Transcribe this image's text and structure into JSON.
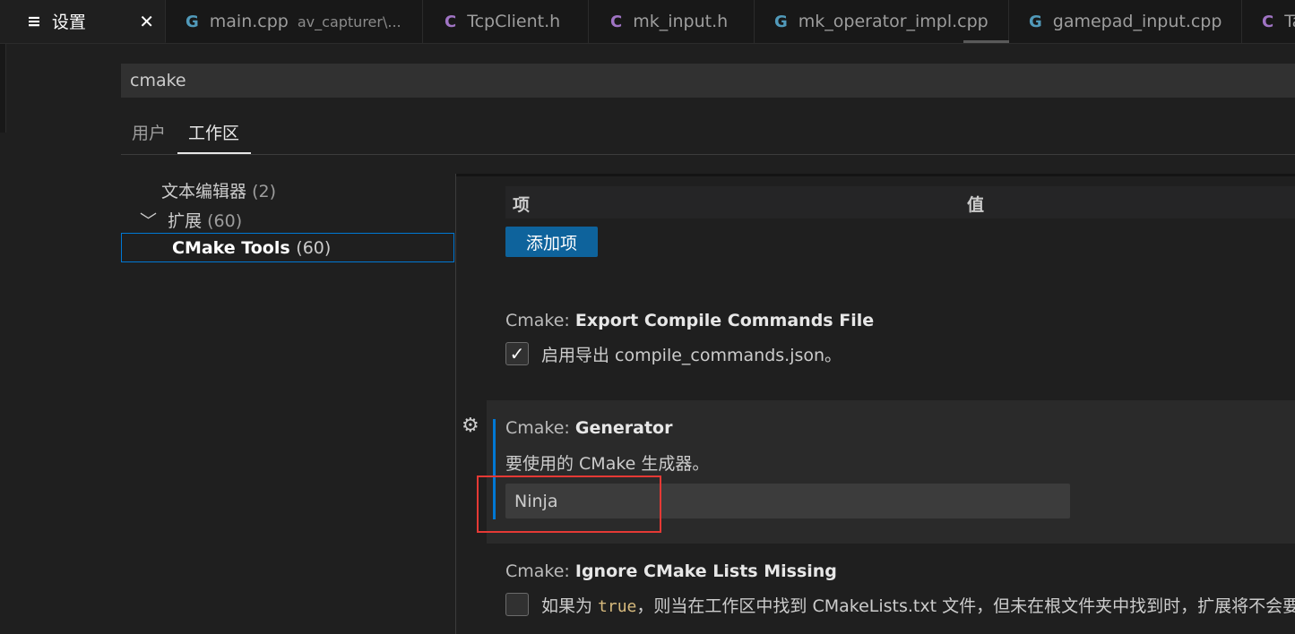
{
  "tabs": [
    {
      "icon": "settings",
      "label": "设置",
      "desc": "",
      "active": true
    },
    {
      "icon": "cpp",
      "label": "main.cpp",
      "desc": "av_capturer\\..."
    },
    {
      "icon": "h",
      "label": "TcpClient.h",
      "desc": ""
    },
    {
      "icon": "h",
      "label": "mk_input.h",
      "desc": ""
    },
    {
      "icon": "cpp",
      "label": "mk_operator_impl.cpp",
      "desc": ""
    },
    {
      "icon": "cpp",
      "label": "gamepad_input.cpp",
      "desc": ""
    },
    {
      "icon": "h",
      "label": "Ta",
      "desc": ""
    }
  ],
  "search": {
    "value": "cmake"
  },
  "scopes": {
    "user": "用户",
    "workspace": "工作区"
  },
  "toc": {
    "text_editor": {
      "label": "文本编辑器",
      "count": "(2)"
    },
    "extensions": {
      "label": "扩展",
      "count": "(60)"
    },
    "cmake_tools": {
      "label": "CMake Tools",
      "count": "(60)"
    }
  },
  "table": {
    "col_item": "项",
    "col_value": "值",
    "add_button": "添加项"
  },
  "settings": {
    "export": {
      "category": "Cmake: ",
      "name": "Export Compile Commands File",
      "description": "启用导出 compile_commands.json。",
      "checked": true
    },
    "generator": {
      "category": "Cmake: ",
      "name": "Generator",
      "description": "要使用的 CMake 生成器。",
      "value": "Ninja"
    },
    "ignore": {
      "category": "Cmake: ",
      "name": "Ignore CMake Lists Missing",
      "desc_prefix": "如果为 ",
      "desc_code": "true",
      "desc_suffix": "，则当在工作区中找到 CMakeLists.txt 文件，但未在根文件夹中找到时，扩展将不会要",
      "checked": false
    }
  },
  "colors": {
    "accent": "#0078d4",
    "button": "#0e639c",
    "highlight": "#e53935"
  }
}
